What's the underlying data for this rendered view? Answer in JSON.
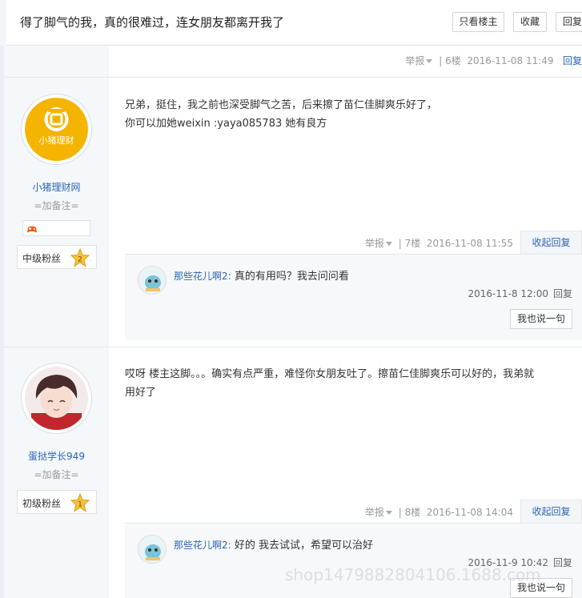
{
  "thread": {
    "title": "得了脚气的我，真的很难过，连女朋友都离开我了",
    "buttons": {
      "only_op": "只看楼主",
      "favorite": "收藏",
      "reply": "回复"
    }
  },
  "floor6_meta": {
    "report": "举报",
    "floor": "| 6楼",
    "time": "2016-11-08 11:49",
    "reply": "回复"
  },
  "posts": [
    {
      "username": "小猪理财网",
      "avatar_logo_text": "小猪理财",
      "remark": "=加备注=",
      "fan_level": "中级粉丝",
      "fan_star": "2",
      "content_lines": [
        "兄弟，挺住，我之前也深受脚气之苦，后来擦了苗仁佳脚爽乐好了，",
        "你可以加她weixin :yaya085783 她有良方"
      ],
      "meta": {
        "report": "举报",
        "floor": "| 7楼",
        "time": "2016-11-08 11:55",
        "collapse": "收起回复"
      },
      "sub_reply": {
        "user": "那些花儿啊2:",
        "text": " 真的有用吗？我去问问看",
        "time": "2016-11-8 12:00",
        "reply": "回复"
      },
      "say_button": "我也说一句"
    },
    {
      "username": "蛋挞学长949",
      "remark": "=加备注=",
      "fan_level": "初级粉丝",
      "fan_star": "1",
      "content_lines": [
        "哎呀 楼主这脚。。。确实有点严重，难怪你女朋友吐了。擦苗仁佳脚爽乐可以好的，我弟就",
        "用好了"
      ],
      "meta": {
        "report": "举报",
        "floor": "| 8楼",
        "time": "2016-11-08 14:04",
        "collapse": "收起回复"
      },
      "sub_reply": {
        "user": "那些花儿啊2:",
        "text": " 好的 我去试试，希望可以治好",
        "time": "2016-11-9 10:42",
        "reply": "回复"
      },
      "say_button": "我也说一句"
    }
  ],
  "watermark": "shop1479882804106.1688.com",
  "colors": {
    "link": "#2d64b3",
    "sidebar": "#f5f8fb",
    "logo_yellow": "#f5b400"
  }
}
